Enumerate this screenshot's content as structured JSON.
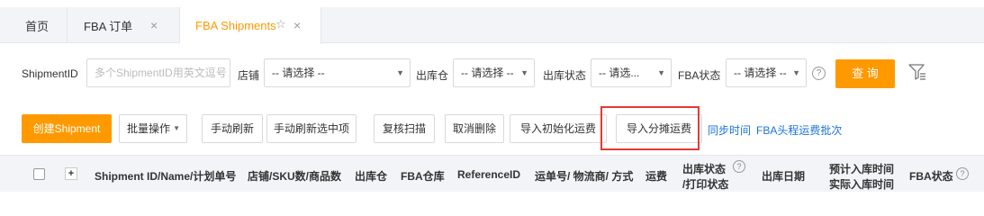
{
  "tabs": {
    "home": "首页",
    "fba_order": "FBA 订单",
    "fba_shipments": "FBA Shipments",
    "close_glyph": "×",
    "star_glyph": "☆"
  },
  "filters": {
    "shipment_id_label": "ShipmentID",
    "shipment_id_placeholder": "多个ShipmentID用英文逗号",
    "store_label": "店铺",
    "store_value": "-- 请选择 --",
    "warehouse_label": "出库仓",
    "warehouse_value": "-- 请选择 --",
    "out_status_label": "出库状态",
    "out_status_value": "-- 请选...",
    "fba_status_label": "FBA状态",
    "fba_status_value": "-- 请选择 --",
    "query_button": "查 询"
  },
  "toolbar": {
    "create_shipment": "创建Shipment",
    "batch_ops": "批量操作",
    "manual_refresh": "手动刷新",
    "manual_refresh_selected": "手动刷新选中项",
    "recheck_scan": "复核扫描",
    "cancel_delete": "取消删除",
    "import_initial_freight": "导入初始化运费",
    "import_allocated_freight": "导入分摊运费",
    "sync_time": "同步时间",
    "fba_head_freight_batch": "FBA头程运费批次"
  },
  "table": {
    "plus": "+",
    "columns": {
      "shipment": "Shipment ID/Name/计划单号",
      "store_sku": "店铺/SKU数/商品数",
      "warehouse": "出库仓",
      "fba_warehouse": "FBA仓库",
      "reference_id": "ReferenceID",
      "tracking": "运单号/ 物流商/ 方式",
      "freight": "运费",
      "out_status_1": "出库状态",
      "out_status_2": "/打印状态",
      "out_date": "出库日期",
      "inbound_1": "预计入库时间",
      "inbound_2": "实际入库时间",
      "fba_status": "FBA状态"
    }
  },
  "colors": {
    "accent": "#ff9900",
    "link": "#1a73d9",
    "highlight": "#e53935"
  }
}
